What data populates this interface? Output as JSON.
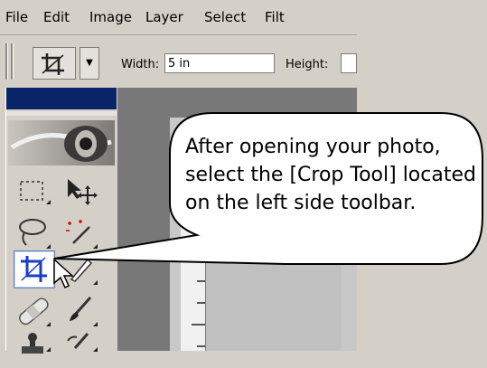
{
  "menu": {
    "file": "File",
    "edit": "Edit",
    "image": "Image",
    "layer": "Layer",
    "select": "Select",
    "filter": "Filt"
  },
  "options": {
    "width_label": "Width:",
    "width_value": "5 in",
    "height_label": "Height:"
  },
  "toolbox": {
    "tools": [
      "marquee-icon",
      "move-icon",
      "lasso-icon",
      "magic-wand-icon",
      "crop-icon",
      "slice-icon",
      "healing-brush-icon",
      "brush-icon",
      "stamp-icon",
      "history-brush-icon"
    ],
    "active_tool": "crop-icon"
  },
  "callout": {
    "text": "After opening your photo, select the [Crop Tool] located on the left side toolbar."
  },
  "colors": {
    "toolbox_title": "#0a246a",
    "workspace": "#787878",
    "chrome": "#d4d0c8"
  }
}
